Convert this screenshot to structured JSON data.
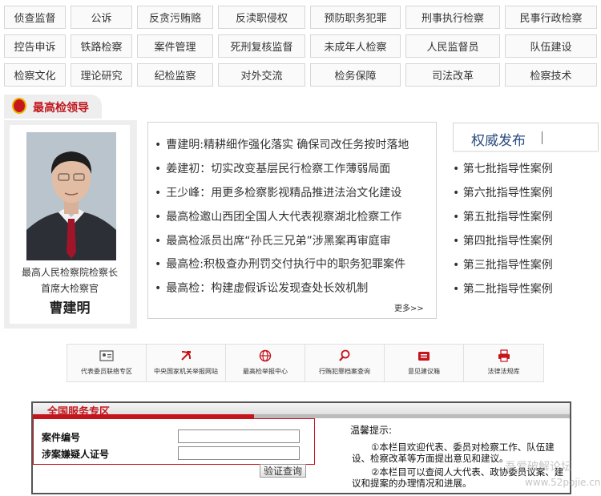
{
  "nav": {
    "row1": [
      "侦查监督",
      "公诉",
      "反贪污贿赂",
      "反渎职侵权",
      "预防职务犯罪",
      "刑事执行检察",
      "民事行政检察"
    ],
    "row2": [
      "控告申诉",
      "铁路检察",
      "案件管理",
      "死刑复核监督",
      "未成年人检察",
      "人民监督员",
      "队伍建设"
    ],
    "row3": [
      "检察文化",
      "理论研究",
      "纪检监察",
      "对外交流",
      "检务保障",
      "司法改革",
      "检察技术"
    ]
  },
  "leader": {
    "section_title": "最高检领导",
    "title_line1": "最高人民检察院检察长",
    "title_line2": "首席大检察官",
    "name": "曹建明"
  },
  "news": {
    "items": [
      "曹建明:精耕细作强化落实 确保司改任务按时落地",
      "姜建初：切实改变基层民行检察工作薄弱局面",
      "王少峰：用更多检察影视精品推进法治文化建设",
      "最高检邀山西团全国人大代表视察湖北检察工作",
      "最高检派员出席“孙氏三兄弟”涉黑案再审庭审",
      "最高检:积极查办刑罚交付执行中的职务犯罪案件",
      "最高检：构建虚假诉讼发现查处长效机制"
    ],
    "more": "更多>>"
  },
  "authority": {
    "title": "权威发布",
    "items": [
      "第七批指导性案例",
      "第六批指导性案例",
      "第五批指导性案例",
      "第四批指导性案例",
      "第三批指导性案例",
      "第二批指导性案例"
    ]
  },
  "services": [
    {
      "label": "代表委员联络专区",
      "icon": "id-card-icon"
    },
    {
      "label": "中央国家机关举报网站",
      "icon": "hammer-sickle-icon"
    },
    {
      "label": "最高检举报中心",
      "icon": "globe-icon"
    },
    {
      "label": "行贿犯罪档案查询",
      "icon": "magnifier-icon"
    },
    {
      "label": "意见建议箱",
      "icon": "mailbox-icon"
    },
    {
      "label": "法律法规库",
      "icon": "printer-icon"
    }
  ],
  "zone": {
    "title": "全国服务专区",
    "case_label": "案件编号",
    "id_label": "涉案嫌疑人证号",
    "case_value": "",
    "id_value": "",
    "button": "验证查询",
    "tip_title": "温馨提示:",
    "tip1": "①本栏目欢迎代表、委员对检察工作、队伍建设、检察改革等方面提出意见和建议。",
    "tip2": "②本栏目可以查阅人大代表、政协委员议案、建议和提案的办理情况和进展。"
  },
  "watermark": {
    "line1": "吾爱破解论坛",
    "line2": "www.52pojie.cn"
  },
  "colors": {
    "accent_red": "#c4151c",
    "title_blue": "#2a4a7e"
  }
}
